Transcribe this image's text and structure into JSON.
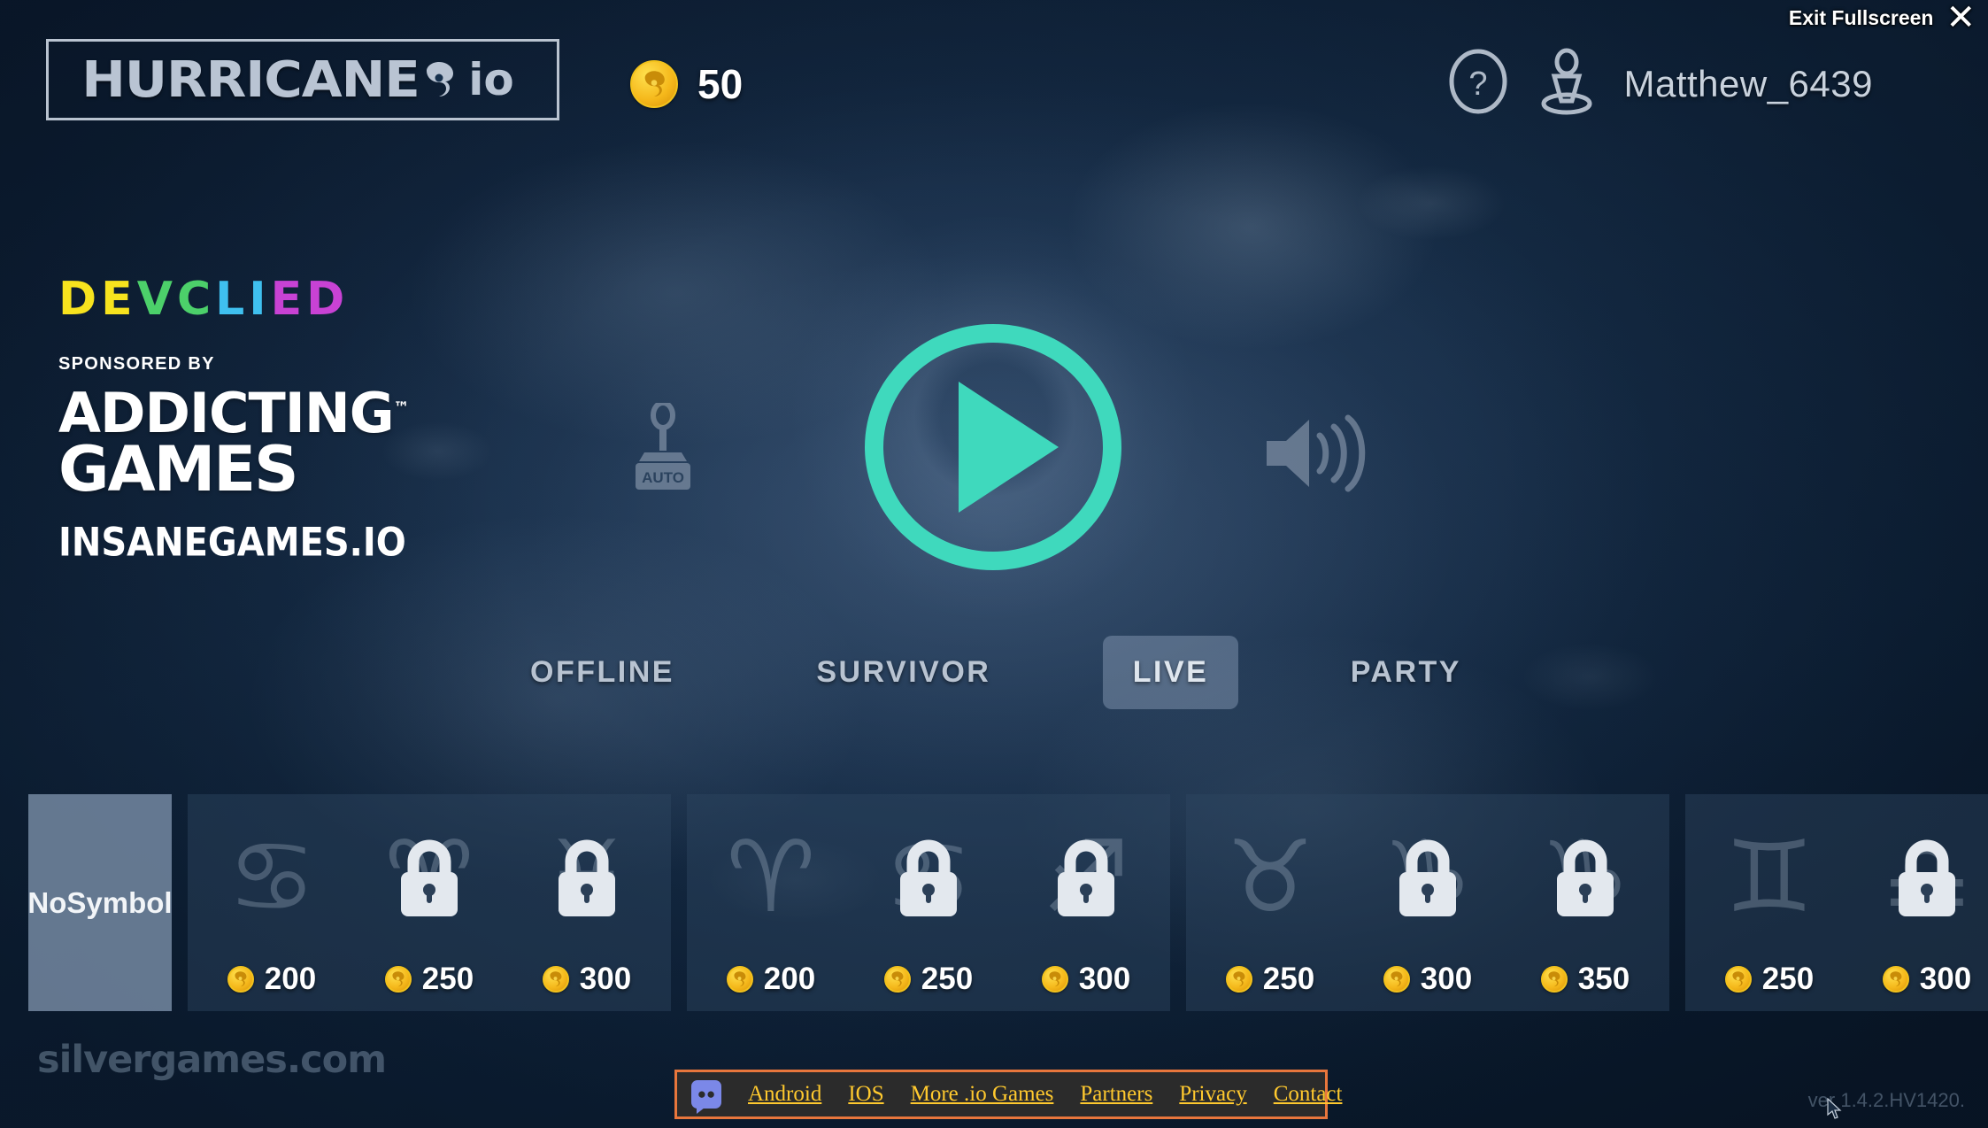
{
  "window": {
    "exit_fullscreen_label": "Exit Fullscreen",
    "close_icon": "close-x-icon"
  },
  "header": {
    "logo_word": "HURRICANE",
    "logo_suffix": "io",
    "logo_icon": "hurricane-icon",
    "coins": {
      "icon": "coin-icon",
      "amount": "50"
    },
    "help_icon": "help-question-icon",
    "avatar_icon": "player-avatar-icon",
    "username": "Matthew_6439"
  },
  "promo": {
    "brand_letters": [
      {
        "char": "D",
        "color": "#f7e31e"
      },
      {
        "char": "E",
        "color": "#f7e31e"
      },
      {
        "char": "V",
        "color": "#4cd06a"
      },
      {
        "char": "C",
        "color": "#4cd06a"
      },
      {
        "char": "L",
        "color": "#3fc0ef"
      },
      {
        "char": "I",
        "color": "#3fc0ef"
      },
      {
        "char": "E",
        "color": "#c842d4"
      },
      {
        "char": "D",
        "color": "#c842d4"
      }
    ],
    "sponsored_label": "SPONSORED BY",
    "sponsor_line1": "ADDICTING",
    "sponsor_line2": "GAMES",
    "sponsor_tm": "™",
    "site": "INSANEGAMES.IO"
  },
  "controls": {
    "joystick_icon": "joystick-icon",
    "joystick_label": "AUTO",
    "play_icon": "play-button-icon",
    "sound_icon": "speaker-volume-icon"
  },
  "modes": [
    {
      "label": "OFFLINE",
      "active": false
    },
    {
      "label": "SURVIVOR",
      "active": false
    },
    {
      "label": "LIVE",
      "active": true
    },
    {
      "label": "PARTY",
      "active": false
    }
  ],
  "shop": {
    "no_symbol_label": "No\nSymbol",
    "no_symbol_selected": true,
    "groups": [
      {
        "slots": [
          {
            "symbol": "zodiac-cancer-icon",
            "locked": false,
            "price": "200"
          },
          {
            "symbol": "zodiac-aries-icon",
            "locked": true,
            "price": "250"
          },
          {
            "symbol": "zodiac-pisces-icon",
            "locked": true,
            "price": "300"
          }
        ]
      },
      {
        "slots": [
          {
            "symbol": "zodiac-aries-icon",
            "locked": false,
            "price": "200"
          },
          {
            "symbol": "zodiac-cancer-icon",
            "locked": true,
            "price": "250"
          },
          {
            "symbol": "zodiac-sagittarius-icon",
            "locked": true,
            "price": "300"
          }
        ]
      },
      {
        "slots": [
          {
            "symbol": "zodiac-taurus-icon",
            "locked": false,
            "price": "250"
          },
          {
            "symbol": "zodiac-capricorn-icon",
            "locked": true,
            "price": "300"
          },
          {
            "symbol": "zodiac-capricorn-icon",
            "locked": true,
            "price": "350"
          }
        ]
      },
      {
        "slots": [
          {
            "symbol": "zodiac-gemini-icon",
            "locked": false,
            "price": "250"
          },
          {
            "symbol": "zodiac-libra-icon",
            "locked": true,
            "price": "300"
          },
          {
            "symbol": "zodiac-scorpio-icon",
            "locked": true,
            "price": ""
          }
        ]
      }
    ]
  },
  "footer": {
    "discord_icon": "discord-icon",
    "links": [
      "Android",
      "IOS",
      "More .io Games",
      "Partners",
      "Privacy",
      "Contact"
    ],
    "border_color": "#e8763c",
    "link_color": "#ffc92e"
  },
  "watermark": "silvergames.com",
  "version": "ver 1.4.2.HV1420.",
  "theme": {
    "accent_teal": "#3fd9bd",
    "background_navy": "#0d1f35",
    "coin_gold": "#f5b81b"
  }
}
